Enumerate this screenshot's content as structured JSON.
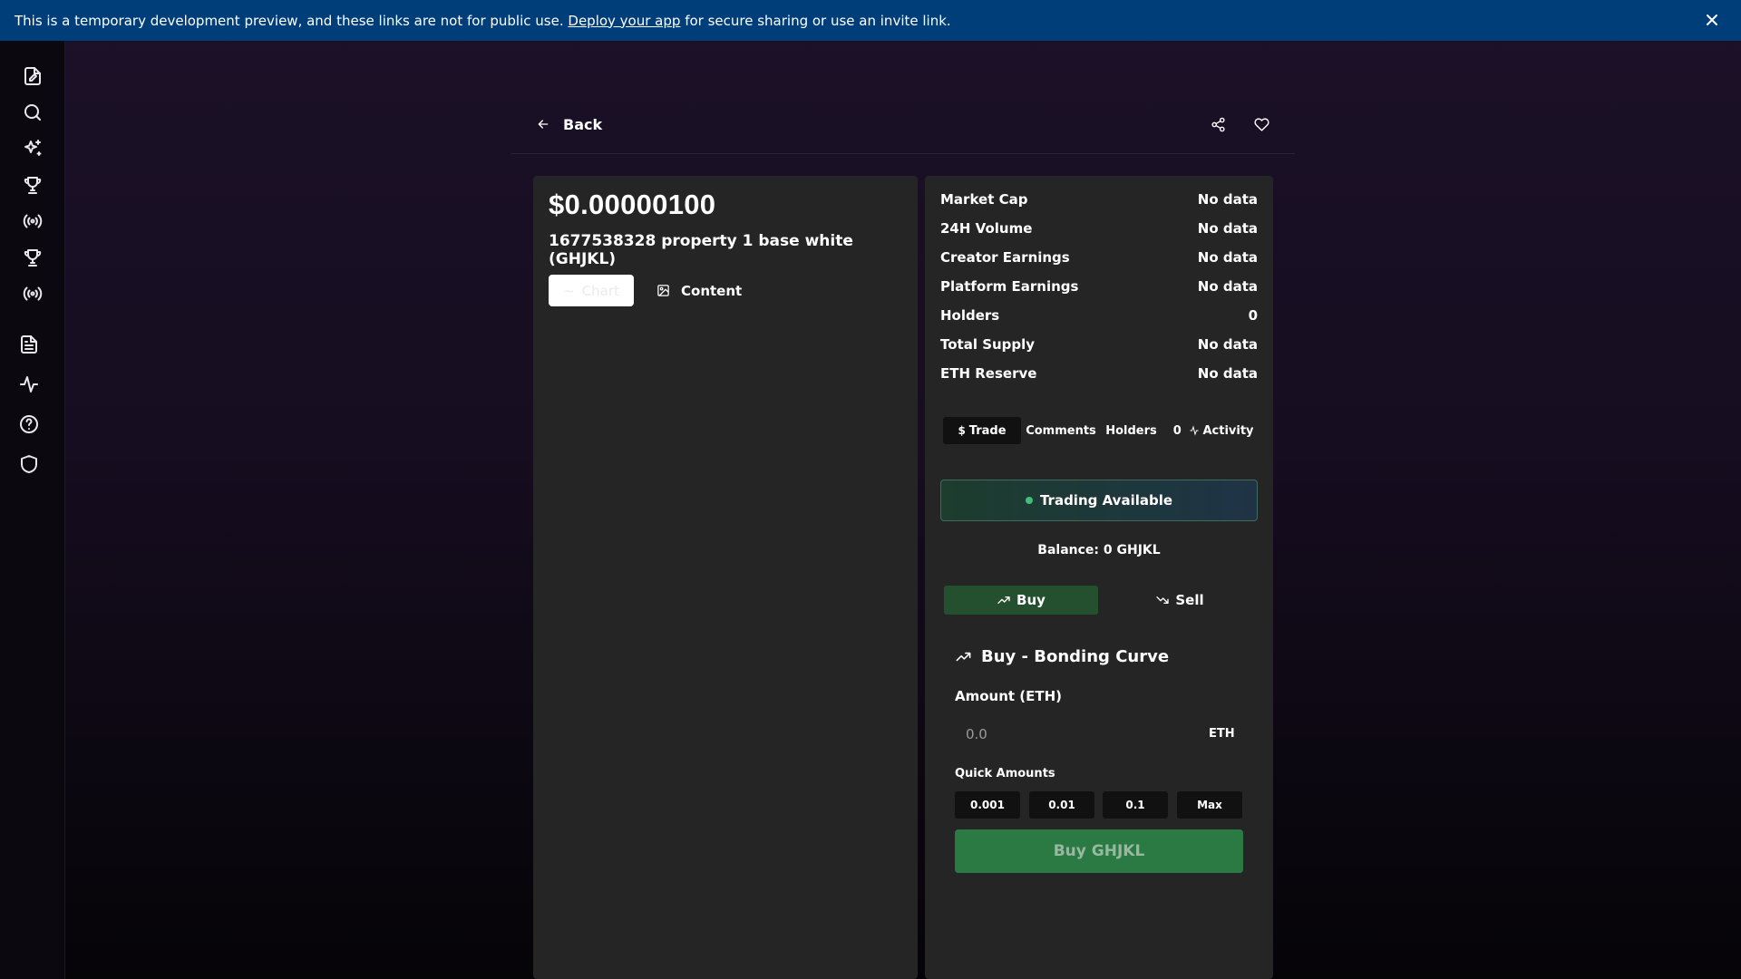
{
  "banner": {
    "text_before": "This is a temporary development preview, and these links are not for public use.",
    "link_text": "Deploy your app",
    "text_after": "for secure sharing or use an invite link."
  },
  "sidebar": {
    "icons": [
      "create-icon",
      "search-icon",
      "sparkles-icon",
      "trophy-icon",
      "broadcast-icon",
      "trophy-icon",
      "broadcast-icon",
      "document-icon",
      "activity-icon",
      "help-icon",
      "shield-icon"
    ]
  },
  "topbar": {
    "back_label": "Back",
    "share_icon": "share-icon",
    "favorite_icon": "heart-icon"
  },
  "token": {
    "price": "$0.00000100",
    "name": "1677538328 property 1 base white (GHJKL)",
    "chart_tab_label": "Chart",
    "content_tab_label": "Content"
  },
  "stats": [
    {
      "label": "Market Cap",
      "value": "No data"
    },
    {
      "label": "24H Volume",
      "value": "No data"
    },
    {
      "label": "Creator Earnings",
      "value": "No data"
    },
    {
      "label": "Platform Earnings",
      "value": "No data"
    },
    {
      "label": "Holders",
      "value": "0"
    },
    {
      "label": "Total Supply",
      "value": "No data"
    },
    {
      "label": "ETH Reserve",
      "value": "No data"
    }
  ],
  "tabs": {
    "trade": "Trade",
    "comments": "Comments",
    "holders": "Holders",
    "holders_count": "0",
    "activity": "Activity"
  },
  "trade": {
    "status": "Trading Available",
    "balance": "Balance: 0 GHJKL",
    "buy_label": "Buy",
    "sell_label": "Sell",
    "section_title": "Buy - Bonding Curve",
    "amount_label": "Amount (ETH)",
    "amount_placeholder": "0.0",
    "amount_unit": "ETH",
    "quick_amounts_label": "Quick Amounts",
    "quick_amounts": [
      "0.001",
      "0.01",
      "0.1",
      "Max"
    ],
    "submit_label": "Buy GHJKL"
  }
}
